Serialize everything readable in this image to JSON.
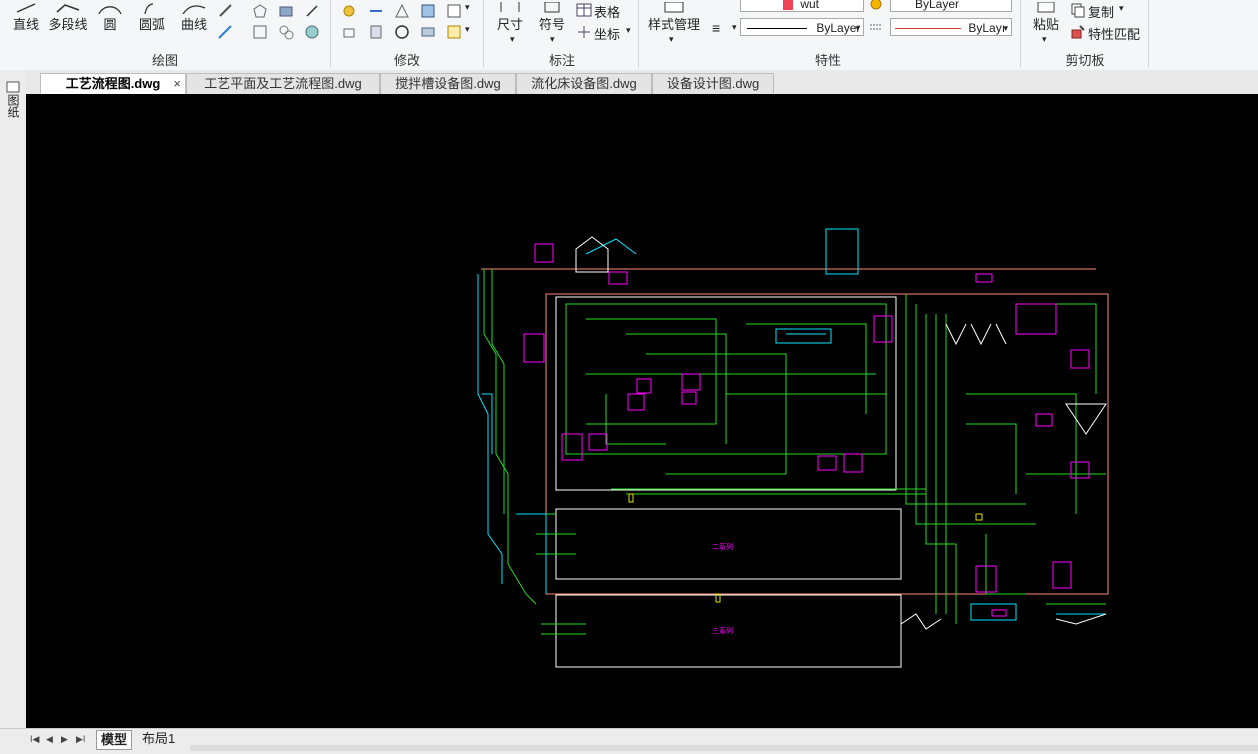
{
  "ribbon": {
    "draw": {
      "title": "绘图",
      "line": "直线",
      "polyline": "多段线",
      "circle": "圆",
      "arc": "圆弧",
      "curve": "曲线"
    },
    "modify": {
      "title": "修改"
    },
    "annotate": {
      "title": "标注",
      "dimension": "尺寸",
      "symbol": "符号",
      "table": "表格",
      "coordinate": "坐标"
    },
    "properties": {
      "title": "特性",
      "style_manager": "样式管理",
      "layer_value": "wut",
      "color_value": "ByLayer",
      "linetype_value": "ByLayer",
      "lineweight_value": "ByLayı"
    },
    "clipboard": {
      "title": "剪切板",
      "paste": "粘贴",
      "copy": "复制",
      "match_prop": "特性匹配"
    }
  },
  "left_strip": {
    "label": "图纸"
  },
  "tabs": [
    {
      "label": "工艺流程图.dwg",
      "active": true
    },
    {
      "label": "工艺平面及工艺流程图.dwg",
      "active": false
    },
    {
      "label": "搅拌槽设备图.dwg",
      "active": false
    },
    {
      "label": "流化床设备图.dwg",
      "active": false
    },
    {
      "label": "设备设计图.dwg",
      "active": false
    }
  ],
  "drawing": {
    "box_label_1": "二系列",
    "box_label_2": "三系列"
  },
  "colors": {
    "canvas_bg": "#000000",
    "green": "#22dd22",
    "magenta": "#ff00ff",
    "cyan": "#00e5ff",
    "salmon": "#ff8c7a",
    "white": "#ffffff",
    "yellow": "#e0e000"
  },
  "layout_tabs": [
    {
      "label": "模型",
      "active": true
    },
    {
      "label": "布局1",
      "active": false
    }
  ]
}
